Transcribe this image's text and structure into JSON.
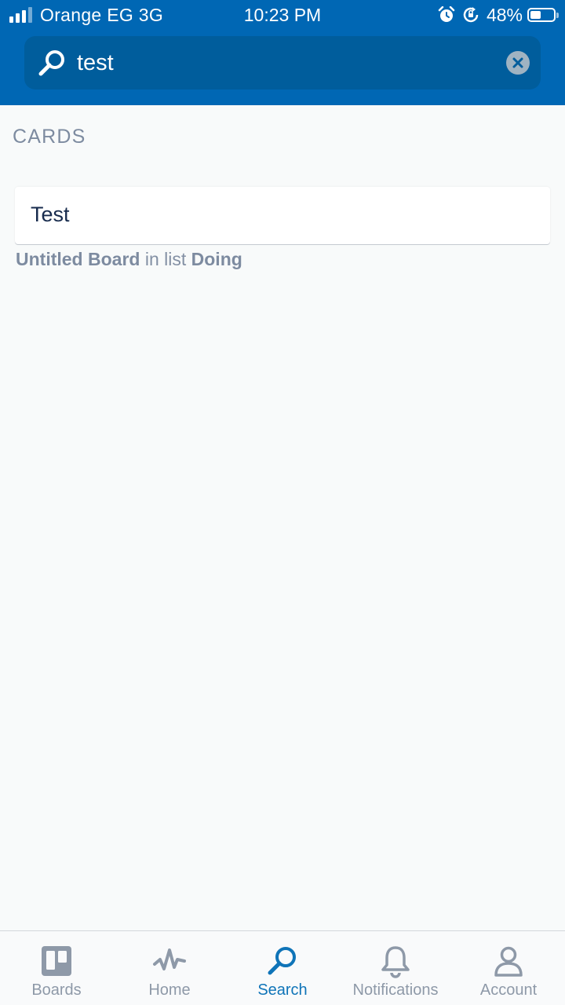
{
  "status_bar": {
    "carrier": "Orange EG  3G",
    "time": "10:23 PM",
    "battery_percent": "48%",
    "battery_level": 0.48,
    "icons": [
      "signal-icon",
      "alarm-icon",
      "rotation-lock-icon",
      "battery-icon"
    ]
  },
  "search": {
    "query": "test",
    "icon": "search-icon",
    "clear_icon": "clear-icon"
  },
  "results": {
    "section_title": "CARDS",
    "cards": [
      {
        "title": "Test",
        "board": "Untitled Board",
        "in_list_text": "in list",
        "list": "Doing"
      }
    ]
  },
  "tab_bar": {
    "tabs": [
      {
        "label": "Boards",
        "icon": "boards-icon",
        "active": false
      },
      {
        "label": "Home",
        "icon": "activity-icon",
        "active": false
      },
      {
        "label": "Search",
        "icon": "search-icon",
        "active": true
      },
      {
        "label": "Notifications",
        "icon": "bell-icon",
        "active": false
      },
      {
        "label": "Account",
        "icon": "user-icon",
        "active": false
      }
    ]
  },
  "colors": {
    "header": "#0067b4",
    "search_field": "#005d9c",
    "active_tab": "#0f74b8",
    "inactive_tab": "#8e99a8",
    "background": "#f8fafa"
  }
}
